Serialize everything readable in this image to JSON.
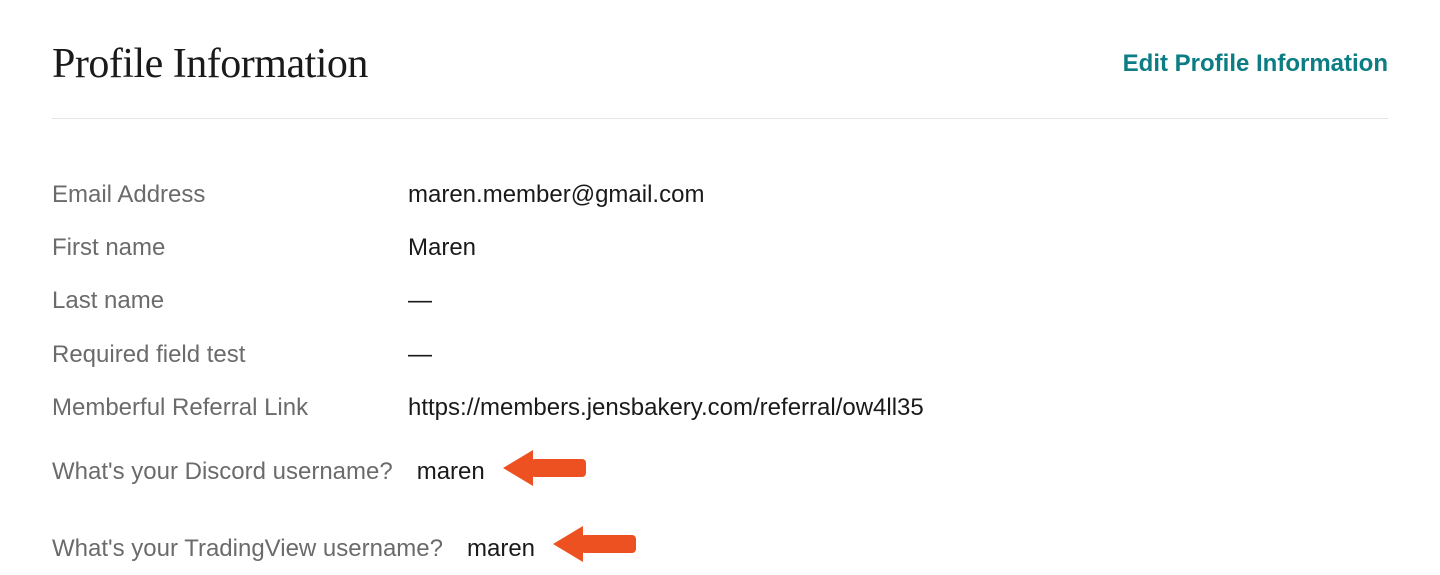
{
  "header": {
    "title": "Profile Information",
    "edit_link": "Edit Profile Information"
  },
  "fields": [
    {
      "label": "Email Address",
      "value": "maren.member@gmail.com",
      "inline": false,
      "has_arrow": false
    },
    {
      "label": "First name",
      "value": "Maren",
      "inline": false,
      "has_arrow": false
    },
    {
      "label": "Last name",
      "value": "—",
      "inline": false,
      "has_arrow": false
    },
    {
      "label": "Required field test",
      "value": "—",
      "inline": false,
      "has_arrow": false
    },
    {
      "label": "Memberful Referral Link",
      "value": "https://members.jensbakery.com/referral/ow4ll35",
      "inline": false,
      "has_arrow": false
    },
    {
      "label": "What's your Discord username?",
      "value": "maren",
      "inline": true,
      "has_arrow": true
    },
    {
      "label": "What's your TradingView username?",
      "value": "maren",
      "inline": true,
      "has_arrow": true
    }
  ],
  "annotation": {
    "arrow_color": "#ed5121"
  }
}
